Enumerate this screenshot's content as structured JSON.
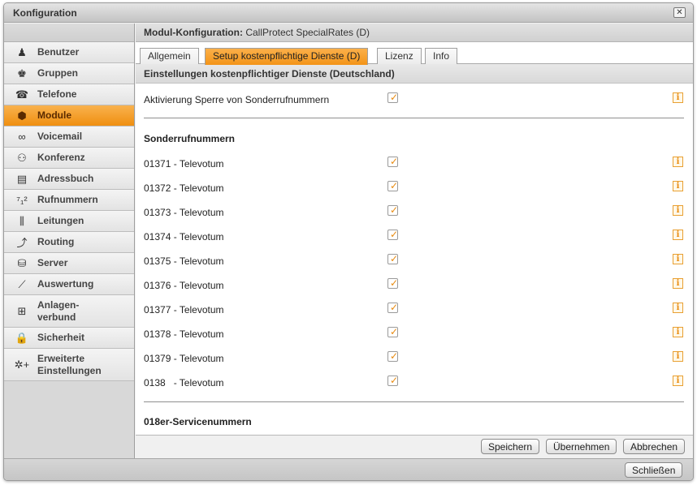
{
  "window": {
    "title": "Konfiguration",
    "close_icon": "close-x-icon"
  },
  "sidebar": {
    "items": [
      {
        "label": "Benutzer",
        "icon": "user-icon",
        "glyph": "♟",
        "active": false
      },
      {
        "label": "Gruppen",
        "icon": "group-icon",
        "glyph": "♚",
        "active": false
      },
      {
        "label": "Telefone",
        "icon": "phone-icon",
        "glyph": "☎",
        "active": false
      },
      {
        "label": "Module",
        "icon": "module-icon",
        "glyph": "⬢",
        "active": true
      },
      {
        "label": "Voicemail",
        "icon": "voicemail-icon",
        "glyph": "∞",
        "active": false
      },
      {
        "label": "Konferenz",
        "icon": "conference-icon",
        "glyph": "⚇",
        "active": false
      },
      {
        "label": "Adressbuch",
        "icon": "addressbook-icon",
        "glyph": "▤",
        "active": false
      },
      {
        "label": "Rufnummern",
        "icon": "numbers-icon",
        "glyph": "⁷₁²",
        "active": false
      },
      {
        "label": "Leitungen",
        "icon": "lines-icon",
        "glyph": "⫼",
        "active": false
      },
      {
        "label": "Routing",
        "icon": "routing-icon",
        "glyph": "⤴",
        "active": false
      },
      {
        "label": "Server",
        "icon": "server-icon",
        "glyph": "⛁",
        "active": false
      },
      {
        "label": "Auswertung",
        "icon": "chart-icon",
        "glyph": "⟋",
        "active": false
      },
      {
        "label": "Anlagen-\nverbund",
        "icon": "network-icon",
        "glyph": "⊞",
        "active": false
      },
      {
        "label": "Sicherheit",
        "icon": "lock-icon",
        "glyph": "🔒",
        "active": false
      },
      {
        "label": "Erweiterte\nEinstellungen",
        "icon": "gear-plus-icon",
        "glyph": "✲+",
        "active": false
      }
    ]
  },
  "header": {
    "label": "Modul-Konfiguration:",
    "value": "CallProtect SpecialRates (D)"
  },
  "tabs": [
    {
      "label": "Allgemein",
      "active": false
    },
    {
      "label": "Setup kostenpflichtige Dienste (D)",
      "active": true
    },
    {
      "label": "Lizenz",
      "active": false
    },
    {
      "label": "Info",
      "active": false
    }
  ],
  "section_title": "Einstellungen kostenpflichtiger Dienste (Deutschland)",
  "activation": {
    "label": "Aktivierung Sperre von Sonderrufnummern",
    "checked": true
  },
  "sonderrufnummern": {
    "heading": "Sonderrufnummern",
    "rows": [
      {
        "label": "01371 - Televotum",
        "checked": true
      },
      {
        "label": "01372 - Televotum",
        "checked": true
      },
      {
        "label": "01373 - Televotum",
        "checked": true
      },
      {
        "label": "01374 - Televotum",
        "checked": true
      },
      {
        "label": "01375 - Televotum",
        "checked": true
      },
      {
        "label": "01376 - Televotum",
        "checked": true
      },
      {
        "label": "01377 - Televotum",
        "checked": true
      },
      {
        "label": "01378 - Televotum",
        "checked": true
      },
      {
        "label": "01379 - Televotum",
        "checked": true
      },
      {
        "label": "0138   - Televotum",
        "checked": true
      }
    ]
  },
  "servicenummern": {
    "heading": "018er-Servicenummern"
  },
  "info_icon_glyph": "i",
  "check_glyph": "✓",
  "footer": {
    "save": "Speichern",
    "apply": "Übernehmen",
    "cancel": "Abbrechen"
  },
  "bottom": {
    "close": "Schließen"
  },
  "colors": {
    "accent": "#f39418",
    "check": "#e98b10"
  }
}
